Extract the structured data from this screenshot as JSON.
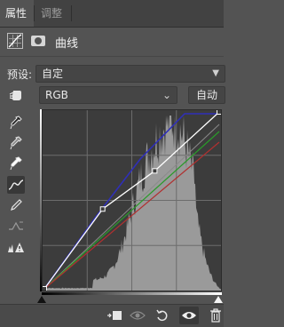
{
  "tabs": [
    {
      "label": "属性",
      "active": true
    },
    {
      "label": "调整",
      "active": false
    }
  ],
  "panel": {
    "title": "曲线",
    "adjustment_icon": "curves-adjustment-icon",
    "mask_icon": "layer-mask-icon"
  },
  "preset": {
    "label": "预设:",
    "value": "自定"
  },
  "channel": {
    "value": "RGB"
  },
  "auto_button": "自动",
  "tools": [
    "on-image-adjust-icon",
    "black-point-eyedropper-icon",
    "gray-point-eyedropper-icon",
    "white-point-eyedropper-icon",
    "curve-edit-points-icon",
    "pencil-draw-icon",
    "smooth-curve-icon",
    "clipping-warning-icon"
  ],
  "colors": {
    "panel_bg": "#535353",
    "graph_bg": "#3c3c3c",
    "histogram": "#9a9a9a",
    "rgb_curve": "#ffffff",
    "blue_curve": "#2f2fb8",
    "red_curve": "#b03030",
    "green_curve": "#2a9a2a"
  },
  "curve_points": [
    {
      "input": 0,
      "output": 0
    },
    {
      "input": 85,
      "output": 115
    },
    {
      "input": 161,
      "output": 170
    },
    {
      "input": 255,
      "output": 255
    }
  ],
  "bottom_icons": [
    "clip-to-layer-icon",
    "view-previous-state-icon",
    "reset-icon",
    "visibility-eye-icon",
    "delete-icon"
  ]
}
